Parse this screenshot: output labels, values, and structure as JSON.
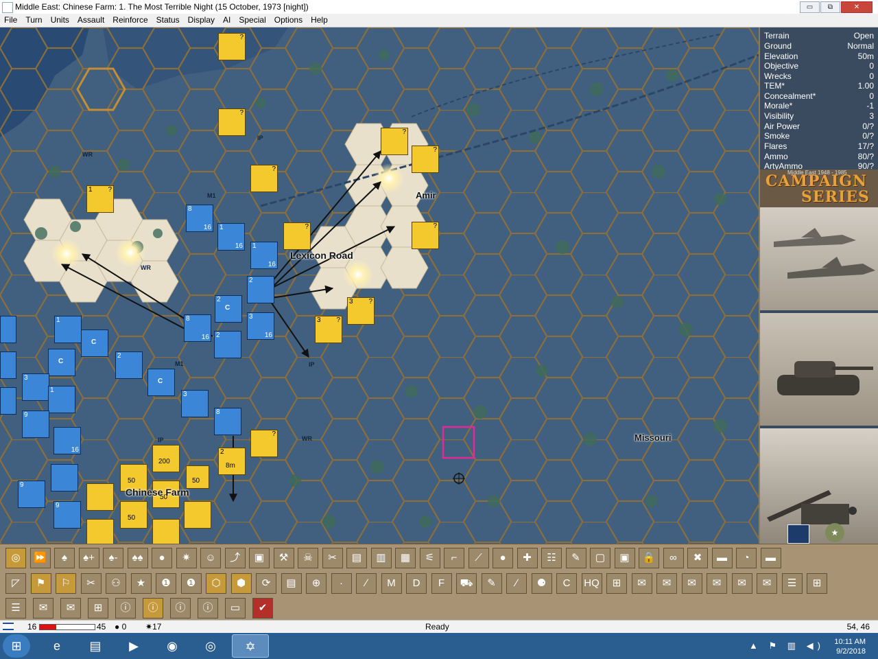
{
  "window": {
    "title": "Middle East: Chinese Farm: 1. The Most Terrible Night (15 October, 1973 [night])",
    "minimize": "▭",
    "restore": "⧉",
    "close": "✕"
  },
  "menu": [
    "File",
    "Turn",
    "Units",
    "Assault",
    "Reinforce",
    "Status",
    "Display",
    "AI",
    "Special",
    "Options",
    "Help"
  ],
  "map": {
    "labels": {
      "lexicon_road": "Lexicon Road",
      "chinese_farm": "Chinese Farm",
      "missouri": "Missouri",
      "amir": "Amir"
    },
    "terrain_marks": [
      "WR",
      "WR",
      "WR",
      "M1",
      "M1",
      "M1",
      "IP",
      "IP",
      "IP",
      "WR",
      "WR",
      "WR",
      "8m"
    ],
    "unit_values": [
      "1",
      "?",
      "2",
      "8",
      "16",
      "C",
      "3",
      "9",
      "50",
      "200",
      "M1"
    ],
    "selection_color": "#e02a9a"
  },
  "info": {
    "rows": [
      {
        "label": "Terrain",
        "value": "Open"
      },
      {
        "label": "Ground",
        "value": "Normal"
      },
      {
        "label": "Elevation",
        "value": "50m"
      },
      {
        "label": "Objective",
        "value": "0"
      },
      {
        "label": "Wrecks",
        "value": "0"
      },
      {
        "label": "TEM*",
        "value": "1.00"
      },
      {
        "label": "Concealment*",
        "value": "0"
      },
      {
        "label": "Morale*",
        "value": "-1"
      },
      {
        "label": "Visibility",
        "value": "3"
      },
      {
        "label": "Air Power",
        "value": "0/?"
      },
      {
        "label": "Smoke",
        "value": "0/?"
      },
      {
        "label": "Flares",
        "value": "17/?"
      },
      {
        "label": "Ammo",
        "value": "80/?"
      },
      {
        "label": "ArtyAmmo",
        "value": "90/?"
      }
    ],
    "logo_line1": "CAMPAIGN",
    "logo_line2": "SERIES",
    "logo_sub": "Middle East 1948 - 1985"
  },
  "toolbar": {
    "row1": [
      "target-icon",
      "fast-forward-icon",
      "grenade-icon",
      "grenade-plus-icon",
      "grenade-minus-icon",
      "grenades-icon",
      "rock-icon",
      "explosion-icon",
      "face-icon",
      "climb-icon",
      "vehicle-icon",
      "shovel-icon",
      "skull-box-icon",
      "tools-icon",
      "cargo-icon",
      "building-icon",
      "fortress-icon",
      "bridge-icon",
      "pistol-icon",
      "rifle-icon",
      "bomb-icon",
      "mine-icon",
      "fence-icon",
      "wrench-icon",
      "truck-icon",
      "truck-load-icon",
      "lock-icon",
      "binoculars-icon",
      "crossed-icon",
      "bag-icon",
      "gauge-icon",
      "disc-icon"
    ],
    "row2": [
      "flag-icon",
      "yellow-flag-icon",
      "map-icon",
      "cut-icon",
      "people-icon",
      "star-icon",
      "hex-one-icon",
      "hex-one-b-icon",
      "hex-map-icon",
      "hex-group-icon",
      "cycle-icon",
      "map-book-icon",
      "shot-icon",
      "dot-icon",
      "line-icon",
      "m-icon",
      "d-icon",
      "f-icon",
      "car-icon",
      "wrench2-icon",
      "pen-icon",
      "balls-icon",
      "c-icon",
      "hq-icon",
      "org-icon",
      "env-plus-icon",
      "env-plus2-icon",
      "env-plus3-icon",
      "env-minus-icon",
      "mail-open-icon",
      "mail-open2-icon",
      "copy-icon",
      "add-icon"
    ],
    "row3": [
      "stack-icon",
      "envelope-icon",
      "envelope2-icon",
      "org-chart-icon",
      "info-truck-icon",
      "info-person-icon",
      "info-envelope-icon",
      "info-book-icon",
      "monitor-icon",
      "check-icon"
    ],
    "row1_glyphs": [
      "◎",
      "⏩",
      "♠",
      "♠+",
      "♠-",
      "♠♠",
      "●",
      "✷",
      "☺",
      "⤴",
      "▣",
      "⚒",
      "☠",
      "✂",
      "▤",
      "▥",
      "▦",
      "⚟",
      "⌐",
      "⟋",
      "●",
      "✚",
      "☷",
      "✎",
      "▢",
      "▣",
      "🔒",
      "∞",
      "✖",
      "▬",
      "◔",
      "▬"
    ],
    "row2_glyphs": [
      "◸",
      "⚑",
      "⚐",
      "✂",
      "⚇",
      "★",
      "❶",
      "❶",
      "⬡",
      "⬢",
      "⟳",
      "▤",
      "⊕",
      "·",
      "∕",
      "M",
      "D",
      "F",
      "⛟",
      "✎",
      "∕",
      "⚈",
      "C",
      "HQ",
      "⊞",
      "✉",
      "✉",
      "✉",
      "✉",
      "✉",
      "✉",
      "☰",
      "⊞"
    ],
    "row3_glyphs": [
      "☰",
      "✉",
      "✉",
      "⊞",
      "ⓘ",
      "ⓘ",
      "ⓘ",
      "ⓘ",
      "▭",
      "✔"
    ]
  },
  "status": {
    "left_value": "16",
    "right_value": "45",
    "progress": 0.3,
    "pieces": "0",
    "flares": "17",
    "message": "Ready",
    "coords": "54, 46"
  },
  "taskbar": {
    "start": "⊞",
    "apps": [
      "e",
      "▤",
      "▶",
      "◉",
      "◎",
      "✡"
    ],
    "time": "10:11 AM",
    "date": "9/2/2018",
    "tray": "▲ ⚑ ▥ ◀)"
  }
}
